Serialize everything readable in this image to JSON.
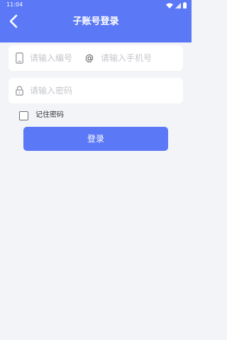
{
  "status_bar": {
    "time": "11:04",
    "icons": [
      "wifi-icon",
      "signal-icon",
      "battery-icon"
    ]
  },
  "header": {
    "title": "子账号登录",
    "back_icon": "chevron-left-icon",
    "background_color": "#5b78f6"
  },
  "account": {
    "icon": "phone-icon",
    "number_placeholder": "请输入编号",
    "at_symbol": "@",
    "phone_placeholder": "请输入手机号"
  },
  "password": {
    "icon": "lock-icon",
    "placeholder": "请输入密码"
  },
  "remember": {
    "label": "记住密码",
    "checked": false
  },
  "login_button": {
    "label": "登录",
    "color": "#5b78f6"
  }
}
